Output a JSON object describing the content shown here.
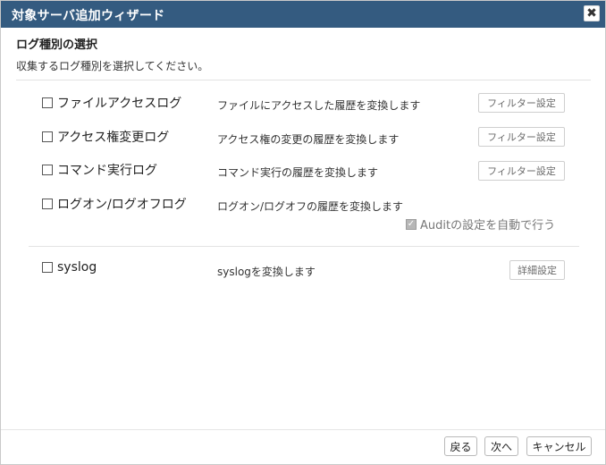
{
  "window": {
    "title": "対象サーバ追加ウィザード",
    "close_glyph": "✖"
  },
  "step": {
    "title": "ログ種別の選択",
    "instruction": "収集するログ種別を選択してください。"
  },
  "log_types": [
    {
      "label": "ファイルアクセスログ",
      "description": "ファイルにアクセスした履歴を変換します",
      "button": "フィルター設定",
      "checked": false
    },
    {
      "label": "アクセス権変更ログ",
      "description": "アクセス権の変更の履歴を変換します",
      "button": "フィルター設定",
      "checked": false
    },
    {
      "label": "コマンド実行ログ",
      "description": "コマンド実行の履歴を変換します",
      "button": "フィルター設定",
      "checked": false
    },
    {
      "label": "ログオン/ログオフログ",
      "description": "ログオン/ログオフの履歴を変換します",
      "checked": false
    }
  ],
  "audit": {
    "label": "Auditの設定を自動で行う",
    "checked": true
  },
  "syslog": {
    "label": "syslog",
    "description": "syslogを変換します",
    "button": "詳細設定",
    "checked": false
  },
  "footer": {
    "back": "戻る",
    "next": "次へ",
    "cancel": "キャンセル"
  }
}
